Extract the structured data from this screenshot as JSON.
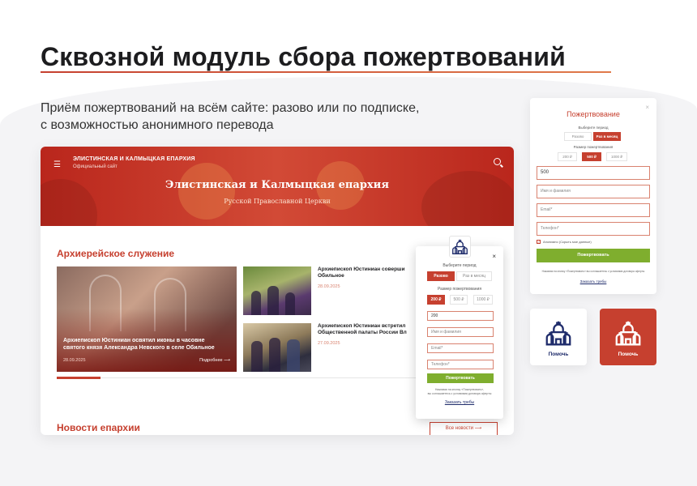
{
  "page": {
    "headline": "Сквозной модуль сбора пожертвований",
    "subtitle_line1": "Приём пожертвований на всём сайте: разово или по подписке,",
    "subtitle_line2": "с возможностью анонимного перевода"
  },
  "site": {
    "header_title": "ЭЛИСТИНСКАЯ И КАЛМЫЦКАЯ ЕПАРХИЯ",
    "header_subtitle": "Официальный сайт",
    "banner_title": "Элистинская и Калмыцкая епархия",
    "banner_subtitle": "Русской Православной Церкви",
    "section_title": "Архиерейское служение",
    "big_card": {
      "text_line1": "Архиепископ Юстиниан освятил иконы в часовне",
      "text_line2": "святого князя Александра Невского в селе Обильное",
      "date": "28.09.2025",
      "more": "Подробнее ⟶"
    },
    "news": [
      {
        "title_line1": "Архиепископ Юстиниан соверши",
        "title_line2": "Обильное",
        "date": "28.09.2025"
      },
      {
        "title_line1": "Архиепископ Юстиниан встретил",
        "title_line2": "Общественной палаты России Вл",
        "date": "27.09.2025"
      }
    ],
    "section2_title": "Новости епархии",
    "all_news": "Все новости ⟶"
  },
  "popup": {
    "choose_period": "Выберите период",
    "period_once": "Разово",
    "period_monthly": "Раз в месяц",
    "amount_label": "Размер пожертвования",
    "amounts": [
      "200 ₽",
      "500 ₽",
      "1000 ₽"
    ],
    "amount_value": "200",
    "name_placeholder": "Имя и фамилия",
    "email_placeholder": "Email*",
    "phone_placeholder": "Телефон*",
    "donate_button": "Пожертвовать",
    "legal_line1": "Нажимая на кнопку «Пожертвовать»,",
    "legal_line2": "вы соглашаетесь с условиями договора оферты",
    "order_prayer": "Заказать требы",
    "close": "×"
  },
  "widget": {
    "title": "Пожертвование",
    "close": "×",
    "choose_period": "Выберите период",
    "period_once": "Разово",
    "period_monthly": "Раз в месяц",
    "amount_label": "Размер пожертвования",
    "amounts": [
      "200 ₽",
      "500 ₽",
      "1000 ₽"
    ],
    "amount_value": "500",
    "name_placeholder": "Имя и фамилия",
    "email_placeholder": "Email*",
    "phone_placeholder": "Телефон*",
    "anonymous_label": "Анонимно (Скрыть мое данные)",
    "donate_button": "Пожертвовать",
    "legal_line": "Нажимая на кнопку «Пожертвовать» вы соглашаетесь с условиями договора оферты",
    "order_prayer": "Заказать требы"
  },
  "help_buttons": [
    {
      "label": "Помочь",
      "style": "white"
    },
    {
      "label": "Помочь",
      "style": "red"
    }
  ],
  "colors": {
    "accent": "#c6402f",
    "green": "#7fae2e",
    "navy": "#1f2c6b"
  }
}
